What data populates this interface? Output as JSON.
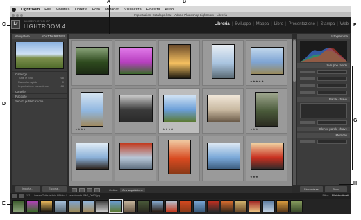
{
  "menubar": {
    "app_name": "Lightroom",
    "items": [
      "File",
      "Modifica",
      "Libreria",
      "Foto",
      "Metadati",
      "Visualizza",
      "Finestra",
      "Aiuto"
    ]
  },
  "titlebar": {
    "text": "Impostazioni Catalogo.lrcat - Adobe Photoshop Lightroom - Libreria"
  },
  "identity": {
    "badge": "Lr",
    "product_small": "ADOBE PHOTOSHOP",
    "product_big": "LIGHTROOM 4"
  },
  "modules": {
    "items": [
      {
        "label": "Libreria",
        "active": true
      },
      {
        "label": "Sviluppo",
        "active": false
      },
      {
        "label": "Mappa",
        "active": false
      },
      {
        "label": "Libro",
        "active": false
      },
      {
        "label": "Presentazione",
        "active": false
      },
      {
        "label": "Stampa",
        "active": false
      },
      {
        "label": "Web",
        "active": false
      }
    ],
    "separator": "|"
  },
  "left_panel": {
    "navigator_label": "Navigatore",
    "navigator_zoom": "ADATTA  RIEMPI",
    "catalog_label": "Catalogo",
    "catalog_items": [
      {
        "label": "Tutte le foto",
        "count": "68"
      },
      {
        "label": "Raccolta rapida",
        "count": "0"
      },
      {
        "label": "Importazione precedente",
        "count": "68"
      }
    ],
    "cartelle_label": "Cartelle",
    "raccolte_label": "Raccolte",
    "servizi_label": "Servizi pubblicazione",
    "import_button": "Importa...",
    "export_button": "Esporta..."
  },
  "grid": {
    "cells": [
      {
        "name": "forest",
        "colors": [
          "#2e4a1e",
          "#8aa37a",
          "#1c2a14"
        ],
        "portrait": false,
        "stars": "",
        "selected": false
      },
      {
        "name": "purple-flower",
        "colors": [
          "#b83fc0",
          "#e07ae8",
          "#3a6b2a"
        ],
        "portrait": false,
        "stars": "",
        "selected": false
      },
      {
        "name": "sunset-trees",
        "colors": [
          "#f5c060",
          "#6a4a2a",
          "#1e1a10"
        ],
        "portrait": true,
        "stars": "",
        "selected": false
      },
      {
        "name": "snowy-trees",
        "colors": [
          "#a9c4e0",
          "#e8eef4",
          "#5a6a74"
        ],
        "portrait": true,
        "stars": "",
        "selected": false
      },
      {
        "name": "coast-hills",
        "colors": [
          "#7ea4d4",
          "#c2d8ec",
          "#9a8a5a"
        ],
        "portrait": false,
        "stars": "★★★★★",
        "selected": false
      },
      {
        "name": "lone-tree",
        "colors": [
          "#8fb6e0",
          "#d8e6f2",
          "#a08a60"
        ],
        "portrait": true,
        "stars": "★★★★",
        "selected": false
      },
      {
        "name": "stormy-sky",
        "colors": [
          "#3a3a3a",
          "#c8c8c8",
          "#2a2a2a"
        ],
        "portrait": false,
        "stars": "",
        "selected": false
      },
      {
        "name": "green-hills",
        "colors": [
          "#6a9ed8",
          "#d0e2f4",
          "#5c7a34"
        ],
        "portrait": false,
        "stars": "★★★★",
        "selected": true
      },
      {
        "name": "sepia-trees",
        "colors": [
          "#c8b8a0",
          "#f0e6d8",
          "#6a5a48"
        ],
        "portrait": false,
        "stars": "",
        "selected": false
      },
      {
        "name": "tree-trunk",
        "colors": [
          "#4a5a3a",
          "#a0a890",
          "#2a2a20"
        ],
        "portrait": true,
        "stars": "★★★",
        "selected": false
      },
      {
        "name": "bare-tree",
        "colors": [
          "#8ab0d8",
          "#e0ecf6",
          "#2a1e14"
        ],
        "portrait": false,
        "stars": "",
        "selected": false
      },
      {
        "name": "golden-gate-a",
        "colors": [
          "#b8c8d8",
          "#c23a1e",
          "#5a6a7a"
        ],
        "portrait": false,
        "stars": "",
        "selected": false
      },
      {
        "name": "golden-gate-b",
        "colors": [
          "#d84a20",
          "#f0c8a0",
          "#8a3a18"
        ],
        "portrait": true,
        "stars": "",
        "selected": false
      },
      {
        "name": "ocean-horizon",
        "colors": [
          "#7aa8d8",
          "#dce8f4",
          "#3a5a7a"
        ],
        "portrait": false,
        "stars": "",
        "selected": false
      },
      {
        "name": "red-tram",
        "colors": [
          "#c83020",
          "#f0d0a0",
          "#2a2a2a"
        ],
        "portrait": false,
        "stars": "★★★",
        "selected": false
      }
    ]
  },
  "toolbar": {
    "sort_label": "Ordina:",
    "sort_value": "Ora acquisizione"
  },
  "right_panel": {
    "histogram_label": "Istogramma",
    "quick_develop_label": "Sviluppo rapido",
    "keywords_label": "Parole chiave",
    "keyword_list_label": "Elenco parole chiave",
    "metadata_label": "Metadati",
    "sync_button": "Sincronizza",
    "sync_settings_button": "Sincr. impostazioni"
  },
  "filmstrip_bar": {
    "page_label": "1 2",
    "source_text": "Libreria  Tutte le foto  68 foto /1 selezionata /IMG_0063.jpg",
    "filter_label": "Filtro:",
    "filter_value": "Filtri disattivati"
  },
  "filmstrip": {
    "thumbs": [
      {
        "colors": [
          "#3a5a2a",
          "#8aa37a"
        ]
      },
      {
        "colors": [
          "#b83fc0",
          "#3a6b2a"
        ]
      },
      {
        "colors": [
          "#f5c060",
          "#1e1a10"
        ]
      },
      {
        "colors": [
          "#a9c4e0",
          "#5a6a74"
        ]
      },
      {
        "colors": [
          "#7ea4d4",
          "#9a8a5a"
        ]
      },
      {
        "colors": [
          "#8fb6e0",
          "#a08a60"
        ]
      },
      {
        "colors": [
          "#3a3a3a",
          "#c8c8c8"
        ]
      },
      {
        "colors": [
          "#6a9ed8",
          "#5c7a34"
        ]
      },
      {
        "colors": [
          "#c8b8a0",
          "#6a5a48"
        ]
      },
      {
        "colors": [
          "#4a5a3a",
          "#2a2a20"
        ]
      },
      {
        "colors": [
          "#8ab0d8",
          "#2a1e14"
        ]
      },
      {
        "colors": [
          "#b8c8d8",
          "#c23a1e"
        ]
      },
      {
        "colors": [
          "#d84a20",
          "#8a3a18"
        ]
      },
      {
        "colors": [
          "#7aa8d8",
          "#3a5a7a"
        ]
      },
      {
        "colors": [
          "#c83020",
          "#2a2a2a"
        ]
      },
      {
        "colors": [
          "#e07030",
          "#3a2a1a"
        ]
      },
      {
        "colors": [
          "#d8b870",
          "#6a4a2a"
        ]
      },
      {
        "colors": [
          "#a02020",
          "#e8c080"
        ]
      },
      {
        "colors": [
          "#5a7aa0",
          "#c0d0e0"
        ]
      },
      {
        "colors": [
          "#e0a040",
          "#5a3a1a"
        ]
      },
      {
        "colors": [
          "#8aa060",
          "#3a4a2a"
        ]
      }
    ],
    "selected_index": 7
  },
  "callouts": {
    "A": "A",
    "B": "B",
    "C": "C",
    "D": "D",
    "E": "E",
    "F": "F",
    "G": "G",
    "H": "H"
  },
  "colors": {
    "background": "#2b2b2b",
    "grid_bg": "#8e8e8e",
    "panel_bg": "#3c3c3c",
    "active_module": "#e8e8e8"
  }
}
